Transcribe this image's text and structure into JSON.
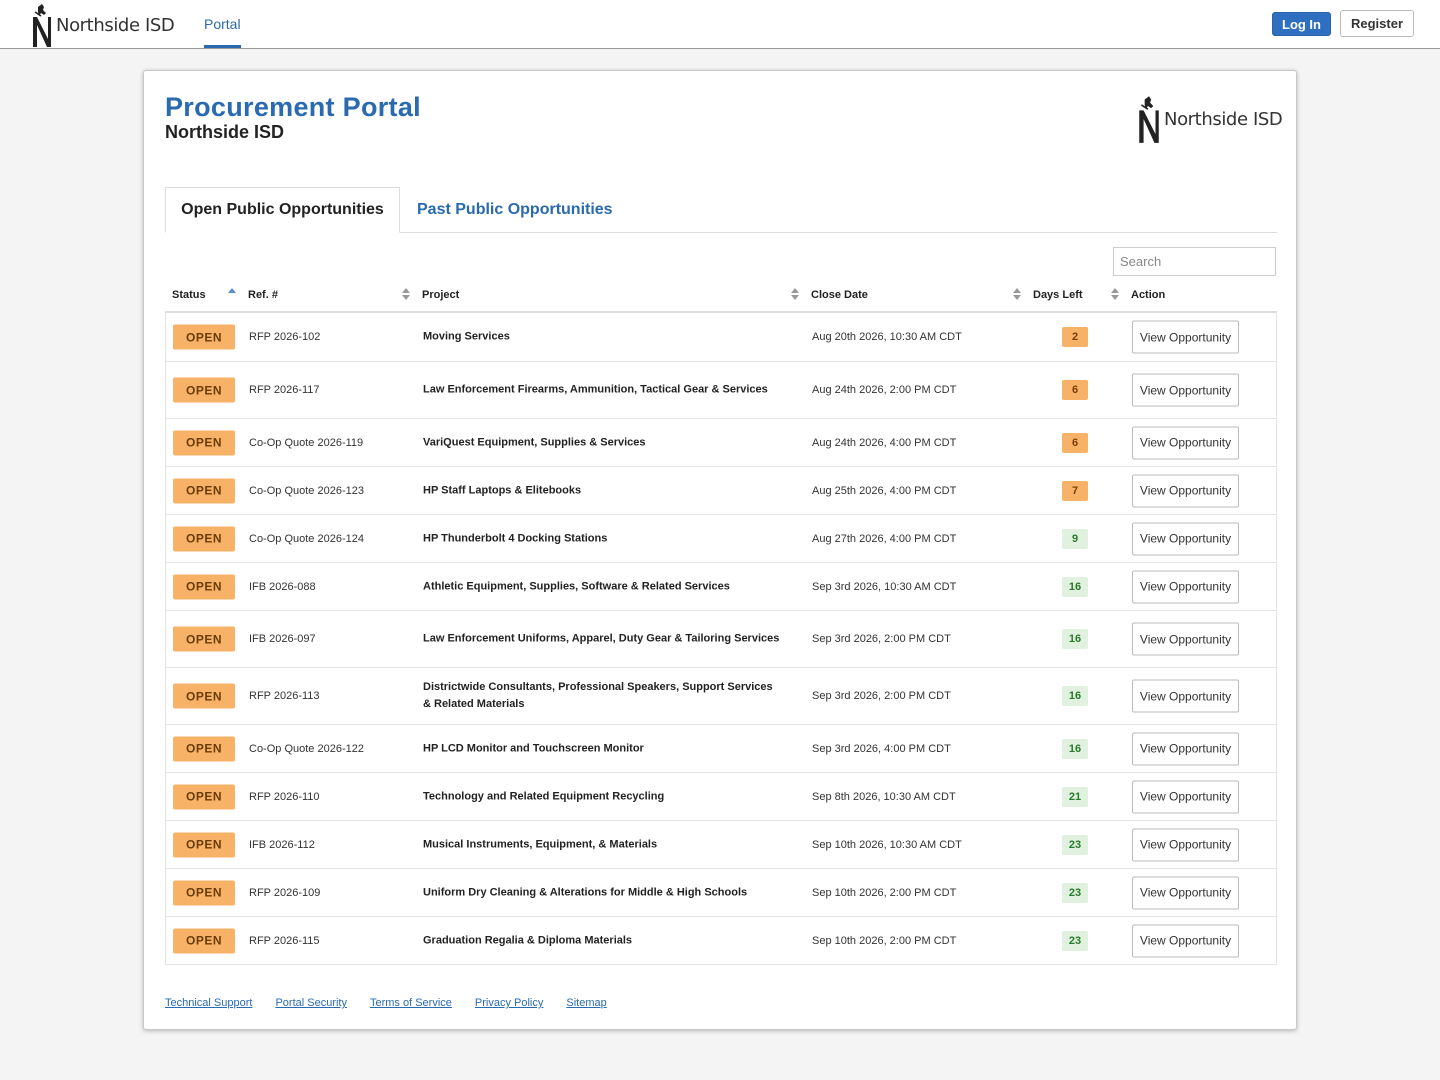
{
  "header": {
    "logo_text": "Northside ISD",
    "portal_tab": "Portal",
    "login_label": "Log In",
    "register_label": "Register"
  },
  "page": {
    "title": "Procurement Portal",
    "subtitle": "Northside ISD",
    "logo_text": "Northside ISD"
  },
  "tabs": {
    "open_label": "Open Public Opportunities",
    "past_label": "Past Public Opportunities"
  },
  "search": {
    "placeholder": "Search"
  },
  "table": {
    "columns": [
      "Status",
      "Ref. #",
      "Project",
      "Close Date",
      "Days Left",
      "Action"
    ],
    "rows": [
      {
        "status": "OPEN",
        "ref": "RFP 2026-102",
        "project": "Moving Services",
        "close": "Aug 20th 2026, 10:30 AM CDT",
        "days": "2",
        "action": "View Opportunity"
      },
      {
        "status": "OPEN",
        "ref": "RFP 2026-117",
        "project": "Law Enforcement Firearms, Ammunition, Tactical Gear & Services",
        "close": "Aug 24th 2026, 2:00 PM CDT",
        "days": "6",
        "action": "View Opportunity"
      },
      {
        "status": "OPEN",
        "ref": "Co-Op Quote 2026-119",
        "project": "VariQuest Equipment, Supplies & Services",
        "close": "Aug 24th 2026, 4:00 PM CDT",
        "days": "6",
        "action": "View Opportunity"
      },
      {
        "status": "OPEN",
        "ref": "Co-Op Quote 2026-123",
        "project": "HP Staff Laptops & Elitebooks",
        "close": "Aug 25th 2026, 4:00 PM CDT",
        "days": "7",
        "action": "View Opportunity"
      },
      {
        "status": "OPEN",
        "ref": "Co-Op Quote 2026-124",
        "project": "HP Thunderbolt 4 Docking Stations",
        "close": "Aug 27th 2026, 4:00 PM CDT",
        "days": "9",
        "action": "View Opportunity"
      },
      {
        "status": "OPEN",
        "ref": "IFB 2026-088",
        "project": "Athletic Equipment, Supplies, Software & Related Services",
        "close": "Sep 3rd 2026, 10:30 AM CDT",
        "days": "16",
        "action": "View Opportunity"
      },
      {
        "status": "OPEN",
        "ref": "IFB 2026-097",
        "project": "Law Enforcement Uniforms, Apparel, Duty Gear & Tailoring Services",
        "close": "Sep 3rd 2026, 2:00 PM CDT",
        "days": "16",
        "action": "View Opportunity"
      },
      {
        "status": "OPEN",
        "ref": "RFP 2026-113",
        "project": "Districtwide Consultants, Professional Speakers, Support Services & Related Materials",
        "close": "Sep 3rd 2026, 2:00 PM CDT",
        "days": "16",
        "action": "View Opportunity"
      },
      {
        "status": "OPEN",
        "ref": "Co-Op Quote 2026-122",
        "project": "HP LCD Monitor and Touchscreen Monitor",
        "close": "Sep 3rd 2026, 4:00 PM CDT",
        "days": "16",
        "action": "View Opportunity"
      },
      {
        "status": "OPEN",
        "ref": "RFP 2026-110",
        "project": "Technology and Related Equipment Recycling",
        "close": "Sep 8th 2026, 10:30 AM CDT",
        "days": "21",
        "action": "View Opportunity"
      },
      {
        "status": "OPEN",
        "ref": "IFB 2026-112",
        "project": "Musical Instruments, Equipment, & Materials",
        "close": "Sep 10th 2026, 10:30 AM CDT",
        "days": "23",
        "action": "View Opportunity"
      },
      {
        "status": "OPEN",
        "ref": "RFP 2026-109",
        "project": "Uniform Dry Cleaning & Alterations for Middle & High Schools",
        "close": "Sep 10th 2026, 2:00 PM CDT",
        "days": "23",
        "action": "View Opportunity"
      },
      {
        "status": "OPEN",
        "ref": "RFP 2026-115",
        "project": "Graduation Regalia & Diploma Materials",
        "close": "Sep 10th 2026, 2:00 PM CDT",
        "days": "23",
        "action": "View Opportunity"
      }
    ]
  },
  "footer": {
    "links": [
      "Technical Support",
      "Portal Security",
      "Terms of Service",
      "Privacy Policy",
      "Sitemap"
    ]
  },
  "colors": {
    "brand_blue": "#2a6ab0",
    "open_badge": "#f7b267",
    "days_urgent": "#f7b267",
    "days_ok": "#e0f1e0"
  }
}
